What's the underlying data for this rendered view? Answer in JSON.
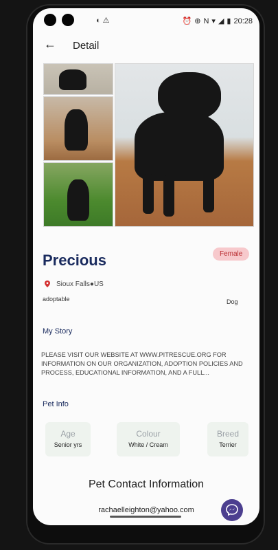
{
  "status_bar": {
    "time": "20:28"
  },
  "header": {
    "title": "Detail"
  },
  "pet": {
    "name": "Precious",
    "gender": "Female",
    "location": "Sioux Falls●US",
    "status": "adoptable",
    "type": "Dog"
  },
  "story": {
    "title": "My Story",
    "text": "PLEASE VISIT OUR WEBSITE AT WWW.PITRESCUE.ORG FOR INFORMATION ON OUR ORGANIZATION, ADOPTION POLICIES AND PROCESS, EDUCATIONAL INFORMATION, AND A FULL..."
  },
  "info": {
    "title": "Pet Info",
    "cards": [
      {
        "label": "Age",
        "value": "Senior yrs"
      },
      {
        "label": "Colour",
        "value": "White / Cream"
      },
      {
        "label": "Breed",
        "value": "Terrier"
      }
    ]
  },
  "contact": {
    "title": "Pet Contact Information",
    "email": "rachaelleighton@yahoo.com"
  },
  "colors": {
    "accent": "#1a2b5e",
    "badge_bg": "#f7c9cc",
    "badge_text": "#b82a2e",
    "fab": "#4c3f8f"
  }
}
